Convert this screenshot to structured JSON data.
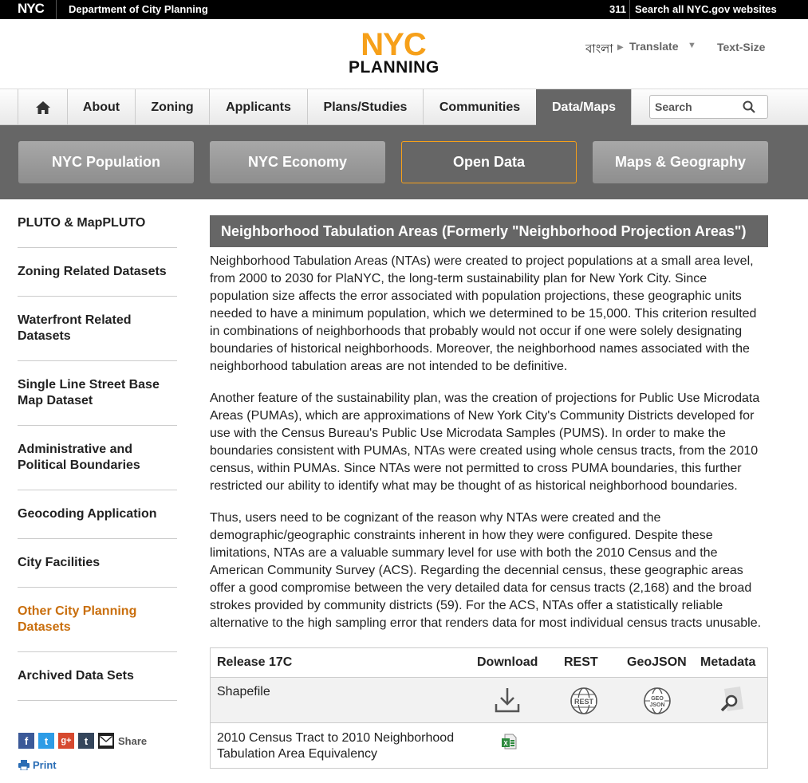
{
  "topbar": {
    "logo_text": "NYC",
    "agency": "Department of City Planning",
    "link_311": "311",
    "search_all": "Search all NYC.gov websites"
  },
  "header": {
    "logo_line1": "NYC",
    "logo_line2": "PLANNING",
    "language": "বাংলা",
    "translate": "Translate",
    "text_size": "Text-Size"
  },
  "nav": {
    "items": [
      {
        "label": "About"
      },
      {
        "label": "Zoning"
      },
      {
        "label": "Applicants"
      },
      {
        "label": "Plans/Studies"
      },
      {
        "label": "Communities"
      },
      {
        "label": "Data/Maps",
        "active": true
      }
    ],
    "search_placeholder": "Search"
  },
  "subnav": {
    "buttons": [
      {
        "label": "NYC Population"
      },
      {
        "label": "NYC Economy"
      },
      {
        "label": "Open Data",
        "active": true
      },
      {
        "label": "Maps & Geography"
      }
    ]
  },
  "sidebar": {
    "items": [
      {
        "label": "PLUTO & MapPLUTO"
      },
      {
        "label": "Zoning Related Datasets"
      },
      {
        "label": "Waterfront Related Datasets"
      },
      {
        "label": "Single Line Street Base Map Dataset"
      },
      {
        "label": "Administrative and Political Boundaries"
      },
      {
        "label": "Geocoding Application"
      },
      {
        "label": "City Facilities"
      },
      {
        "label": "Other City Planning Datasets",
        "current": true
      },
      {
        "label": "Archived Data Sets"
      }
    ],
    "share": {
      "facebook": "f",
      "twitter": "t",
      "googleplus": "g+",
      "tumblr": "t",
      "label": "Share"
    },
    "print_label": "Print"
  },
  "main": {
    "title": "Neighborhood Tabulation Areas (Formerly \"Neighborhood Projection Areas\")",
    "paragraphs": [
      "Neighborhood Tabulation Areas (NTAs) were created to project populations at a small area level, from 2000 to 2030 for PlaNYC, the long-term sustainability plan for New York City. Since population size affects the error associated with population projections, these geographic units needed to have a minimum population, which we determined to be 15,000. This criterion resulted in combinations of neighborhoods that probably would not occur if one were solely designating boundaries of historical neighborhoods. Moreover, the neighborhood names associated with the neighborhood tabulation areas are not intended to be definitive.",
      "Another feature of the sustainability plan, was the creation of projections for Public Use Microdata Areas (PUMAs), which are approximations of New York City's Community Districts developed for use with the Census Bureau's Public Use Microdata Samples (PUMS). In order to make the boundaries consistent with PUMAs, NTAs were created using whole census tracts, from the 2010 census, within PUMAs. Since NTAs were not permitted to cross PUMA boundaries, this further restricted our ability to identify what may be thought of as historical neighborhood boundaries.",
      "Thus, users need to be cognizant of the reason why NTAs were created and the demographic/geographic constraints inherent in how they were configured. Despite these limitations, NTAs are a valuable summary level for use with both the 2010 Census and the American Community Survey (ACS). Regarding the decennial census, these geographic areas offer a good compromise between the very detailed data for census tracts (2,168) and the broad strokes provided by community districts (59). For the ACS, NTAs offer a statistically reliable alternative to the high sampling error that renders data for most individual census tracts unusable."
    ],
    "table": {
      "headers": [
        "Release 17C",
        "Download",
        "REST",
        "GeoJSON",
        "Metadata"
      ],
      "rows": [
        {
          "name": "Shapefile",
          "icons": [
            "download-icon",
            "rest-globe-icon",
            "geojson-globe-icon",
            "metadata-magnifier-icon"
          ],
          "rest_text": "REST",
          "geojson_text": "GEO JSON"
        },
        {
          "name": "2010 Census Tract to 2010 Neighborhood Tabulation Area Equivalency",
          "icons": [
            "excel-file-icon"
          ]
        }
      ]
    }
  }
}
